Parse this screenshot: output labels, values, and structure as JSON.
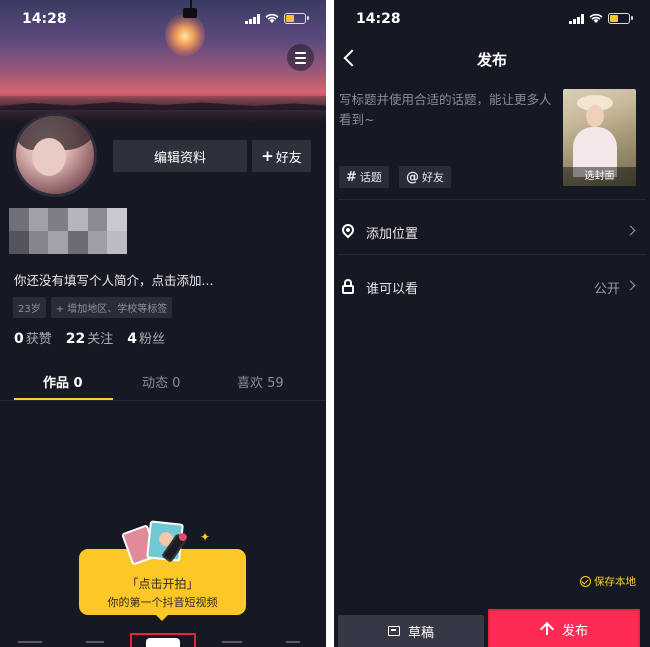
{
  "profile_screen": {
    "status_time": "14:28",
    "edit_profile_label": "编辑资料",
    "add_friend_label": "好友",
    "bio_placeholder": "你还没有填写个人简介，点击添加...",
    "tags": [
      "23岁",
      "+ 增加地区、学校等标签"
    ],
    "stats": [
      {
        "num": "0",
        "label": "获赞"
      },
      {
        "num": "22",
        "label": "关注"
      },
      {
        "num": "4",
        "label": "粉丝"
      }
    ],
    "tabs": [
      {
        "label": "作品 0",
        "active": true
      },
      {
        "label": "动态 0",
        "active": false
      },
      {
        "label": "喜欢 59",
        "active": false
      }
    ],
    "shoot_tip": {
      "line1": "「点击开拍」",
      "line2": "你的第一个抖音短视频"
    }
  },
  "publish_screen": {
    "status_time": "14:28",
    "title": "发布",
    "description_placeholder": "写标题并使用合适的话题，能让更多人看到~",
    "cover_label": "选封面",
    "chips": [
      {
        "symbol": "#",
        "label": "话题"
      },
      {
        "symbol": "@",
        "label": "好友"
      }
    ],
    "location_label": "添加位置",
    "visibility_label": "谁可以看",
    "visibility_value": "公开",
    "save_local_label": "保存本地",
    "draft_label": "草稿",
    "publish_label": "发布"
  },
  "colors": {
    "background": "#161823",
    "accent_yellow": "#facd33",
    "publish_red": "#fe2c55",
    "highlight_box": "#e7243a"
  }
}
